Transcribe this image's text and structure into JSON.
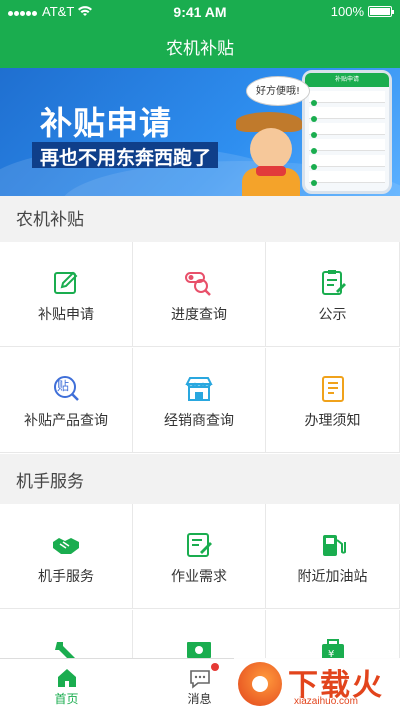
{
  "status": {
    "carrier": "AT&T",
    "time": "9:41 AM",
    "battery": "100%"
  },
  "nav": {
    "title": "农机补贴"
  },
  "banner": {
    "title": "补贴申请",
    "subtitle": "再也不用东奔西跑了",
    "bubble": "好方便哦!",
    "phone_header": "补贴申请"
  },
  "section1": {
    "title": "农机补贴"
  },
  "grid1": [
    {
      "label": "补贴申请",
      "icon": "edit-icon"
    },
    {
      "label": "进度查询",
      "icon": "progress-search-icon"
    },
    {
      "label": "公示",
      "icon": "notice-icon"
    },
    {
      "label": "补贴产品查询",
      "icon": "product-search-icon"
    },
    {
      "label": "经销商查询",
      "icon": "store-icon"
    },
    {
      "label": "办理须知",
      "icon": "guide-icon"
    }
  ],
  "section2": {
    "title": "机手服务"
  },
  "grid2": [
    {
      "label": "机手服务",
      "icon": "handshake-icon"
    },
    {
      "label": "作业需求",
      "icon": "task-icon"
    },
    {
      "label": "附近加油站",
      "icon": "fuel-icon"
    },
    {
      "label": "",
      "icon": "repair-icon"
    },
    {
      "label": "",
      "icon": "cash-icon"
    },
    {
      "label": "",
      "icon": "wallet-icon"
    }
  ],
  "tabs": [
    {
      "label": "首页",
      "icon": "home-icon"
    },
    {
      "label": "消息",
      "icon": "message-icon"
    }
  ],
  "watermark": {
    "title": "下载火",
    "url": "xiazaihuo.com"
  },
  "colors": {
    "brand": "#1aad4f",
    "badge": "#e53935"
  }
}
